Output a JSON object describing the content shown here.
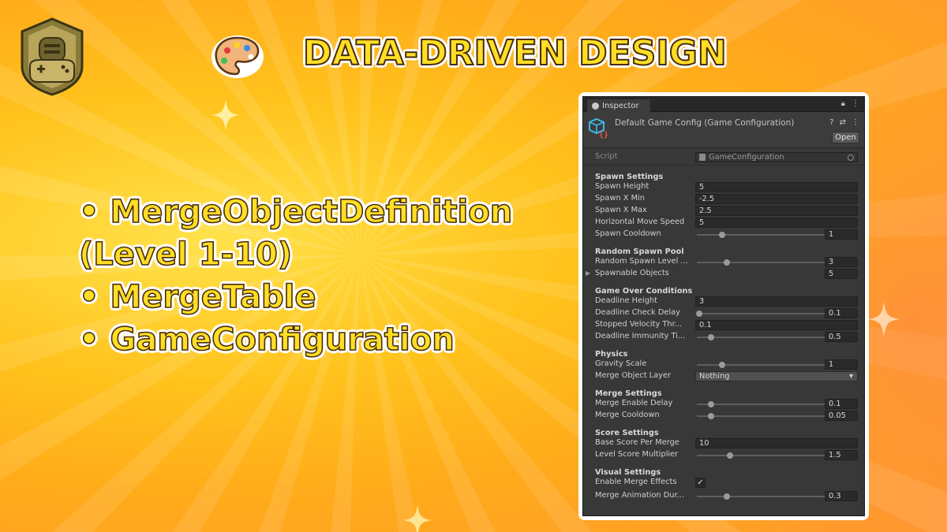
{
  "title": "DATA-DRIVEN DESIGN",
  "bullets": [
    "• MergeObjectDefinition",
    "(Level 1-10)",
    "• MergeTable",
    "• GameConfiguration"
  ],
  "inspector": {
    "tab_label": "Inspector",
    "header_title": "Default Game Config (Game Configuration)",
    "open_label": "Open",
    "script_label": "Script",
    "script_value": "GameConfiguration",
    "sections": {
      "spawn": {
        "title": "Spawn Settings",
        "spawn_height": {
          "label": "Spawn Height",
          "value": "5"
        },
        "spawn_x_min": {
          "label": "Spawn X Min",
          "value": "-2.5"
        },
        "spawn_x_max": {
          "label": "Spawn X Max",
          "value": "2.5"
        },
        "horizontal_move_speed": {
          "label": "Horizontal Move Speed",
          "value": "5"
        },
        "spawn_cooldown": {
          "label": "Spawn Cooldown",
          "value": "1"
        }
      },
      "random_pool": {
        "title": "Random Spawn Pool",
        "random_spawn_level": {
          "label": "Random Spawn Level ...",
          "value": "3"
        },
        "spawnable_objects": {
          "label": "Spawnable Objects",
          "value": "5"
        }
      },
      "game_over": {
        "title": "Game Over Conditions",
        "deadline_height": {
          "label": "Deadline Height",
          "value": "3"
        },
        "deadline_check_delay": {
          "label": "Deadline Check Delay",
          "value": "0.1"
        },
        "stopped_velocity": {
          "label": "Stopped Velocity Thr...",
          "value": "0.1"
        },
        "deadline_immunity": {
          "label": "Deadline Immunity Ti...",
          "value": "0.5"
        }
      },
      "physics": {
        "title": "Physics",
        "gravity_scale": {
          "label": "Gravity Scale",
          "value": "1"
        },
        "merge_object_layer": {
          "label": "Merge Object Layer",
          "value": "Nothing"
        }
      },
      "merge": {
        "title": "Merge Settings",
        "merge_enable_delay": {
          "label": "Merge Enable Delay",
          "value": "0.1"
        },
        "merge_cooldown": {
          "label": "Merge Cooldown",
          "value": "0.05"
        }
      },
      "score": {
        "title": "Score Settings",
        "base_score": {
          "label": "Base Score Per Merge",
          "value": "10"
        },
        "level_multiplier": {
          "label": "Level Score Multiplier",
          "value": "1.5"
        }
      },
      "visual": {
        "title": "Visual Settings",
        "enable_merge_effects": {
          "label": "Enable Merge Effects",
          "checked": true
        },
        "merge_animation": {
          "label": "Merge Animation Dur...",
          "value": "0.3"
        }
      }
    }
  },
  "colors": {
    "title_fill": "#ffde26",
    "title_outline": "#4a2d08",
    "inspector_bg": "#383838",
    "field_bg": "#2a2a2a"
  },
  "icons": [
    "knight-gamepad-logo-icon",
    "palette-icon",
    "sparkle-icon",
    "scriptable-object-icon",
    "lock-icon",
    "kebab-menu-icon",
    "help-icon",
    "presets-icon"
  ]
}
